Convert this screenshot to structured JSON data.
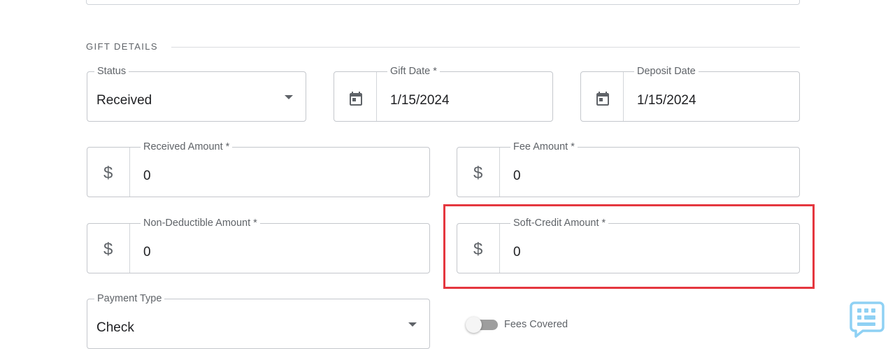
{
  "section": {
    "title": "GIFT DETAILS"
  },
  "status": {
    "label": "Status",
    "value": "Received",
    "icon": "chevron-down-icon"
  },
  "gift_date": {
    "label": "Gift Date *",
    "value": "1/15/2024",
    "icon": "calendar-icon"
  },
  "deposit_date": {
    "label": "Deposit Date",
    "value": "1/15/2024",
    "icon": "calendar-icon"
  },
  "received_amount": {
    "label": "Received Amount *",
    "prefix": "$",
    "value": "0"
  },
  "fee_amount": {
    "label": "Fee Amount *",
    "prefix": "$",
    "value": "0"
  },
  "non_deductible_amount": {
    "label": "Non-Deductible Amount *",
    "prefix": "$",
    "value": "0"
  },
  "soft_credit_amount": {
    "label": "Soft-Credit Amount *",
    "prefix": "$",
    "value": "0"
  },
  "payment_type": {
    "label": "Payment Type",
    "value": "Check",
    "icon": "chevron-down-icon"
  },
  "fees_covered": {
    "label": "Fees Covered",
    "checked": false
  },
  "chat_widget": {
    "icon": "chat-keyboard-icon"
  },
  "colors": {
    "highlight": "#e5373f",
    "chat_icon": "#8fd1f4",
    "toggle_off": "#9e9e9e"
  }
}
